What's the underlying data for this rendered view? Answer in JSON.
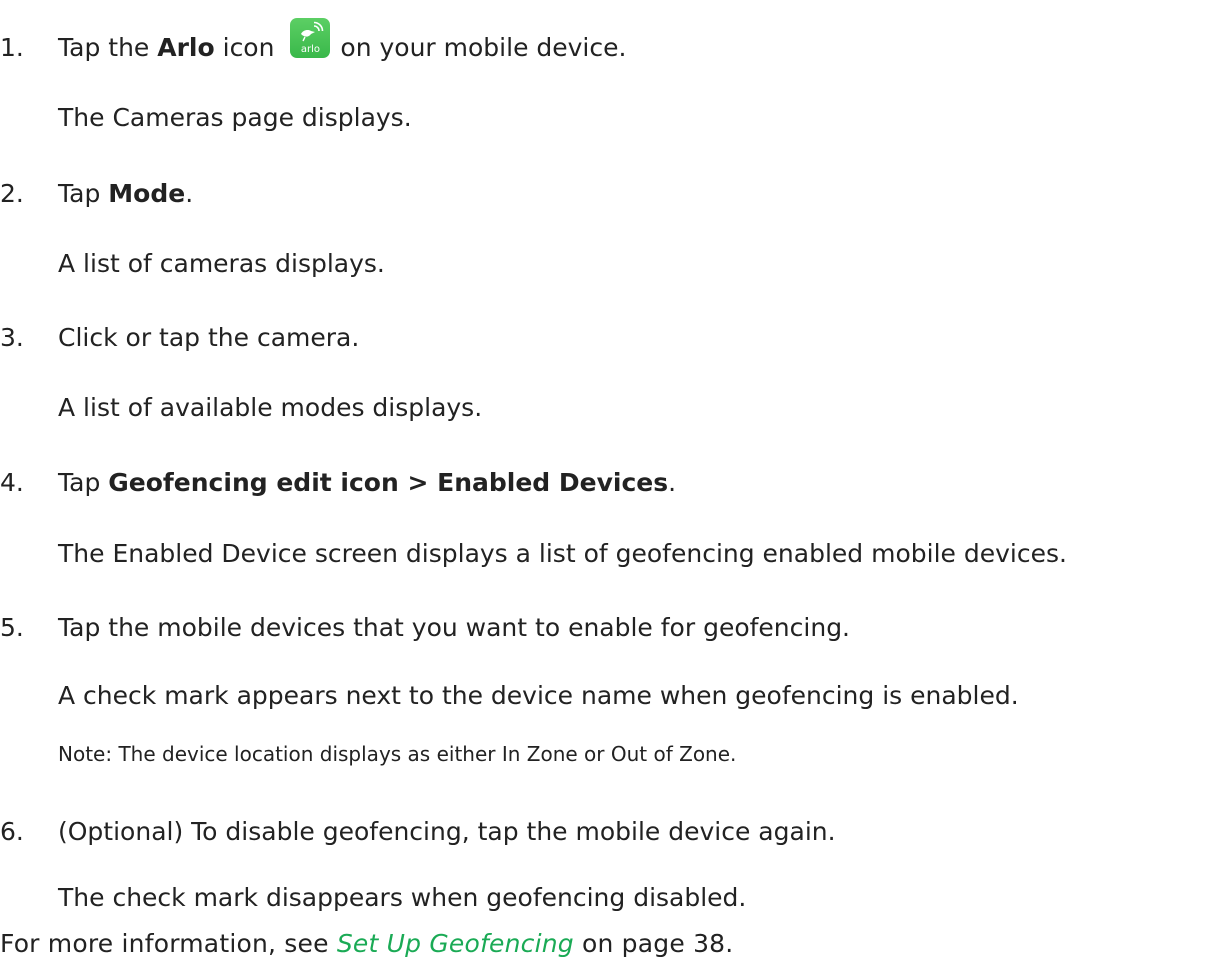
{
  "steps": [
    {
      "num": "1.",
      "pre": "Tap the ",
      "bold": "Arlo",
      "mid": " icon",
      "icon": "arlo-app-icon",
      "post": "on your mobile device.",
      "result": "The Cameras page displays."
    },
    {
      "num": "2.",
      "pre": "Tap ",
      "bold": "Mode",
      "post": ".",
      "result": "A list of cameras displays."
    },
    {
      "num": "3.",
      "text": "Click or tap the camera.",
      "result": "A list of available modes displays."
    },
    {
      "num": "4.",
      "pre": "Tap ",
      "bold": "Geofencing edit icon > Enabled Devices",
      "post": ".",
      "result": "The Enabled Device screen displays a list of geofencing enabled mobile devices."
    },
    {
      "num": "5.",
      "text": "Tap the mobile devices that you want to enable for geofencing.",
      "result": "A check mark appears next to the device name when geofencing is enabled.",
      "note": "Note: The device location displays as either In Zone or Out of Zone."
    },
    {
      "num": "6.",
      "text": "(Optional) To disable geofencing, tap the mobile device again.",
      "result": "The check mark disappears when geofencing disabled."
    }
  ],
  "footer": {
    "pre": "For more information, see ",
    "link": "Set Up Geofencing",
    "post": " on page 38."
  },
  "icon_label": "arlo",
  "colors": {
    "text": "#222222",
    "link": "#1aaa55",
    "icon_bg": "#44be50"
  }
}
